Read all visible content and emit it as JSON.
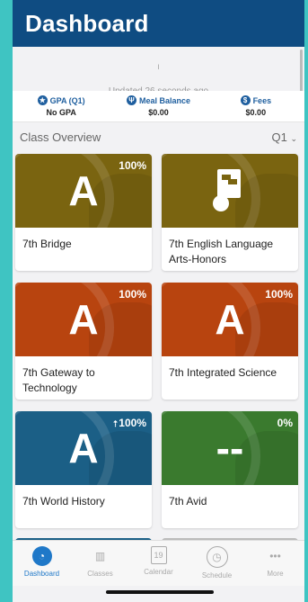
{
  "header": {
    "title": "Dashboard"
  },
  "refresh": {
    "indicator": "ı",
    "updated": "Updated 26 seconds ago"
  },
  "summary": [
    {
      "icon": "star-icon",
      "label": "GPA (Q1)",
      "value": "No GPA"
    },
    {
      "icon": "meal-icon",
      "label": "Meal Balance",
      "value": "$0.00"
    },
    {
      "icon": "dollar-icon",
      "label": "Fees",
      "value": "$0.00"
    }
  ],
  "overview": {
    "title": "Class Overview",
    "quarter": "Q1"
  },
  "classes": [
    {
      "name": "7th Bridge",
      "grade": "A",
      "percent": "100%",
      "color": "#7a6410"
    },
    {
      "name": "7th English Language Arts-Honors",
      "grade": "",
      "percent": "",
      "color": "#7a6410"
    },
    {
      "name": "7th Gateway to Technology",
      "grade": "A",
      "percent": "100%",
      "color": "#b8440f"
    },
    {
      "name": "7th Integrated Science",
      "grade": "A",
      "percent": "100%",
      "color": "#b8440f"
    },
    {
      "name": "7th World History",
      "grade": "A",
      "percent": "100%",
      "color": "#1b5f86"
    },
    {
      "name": "7th Avid",
      "grade": "--",
      "percent": "0%",
      "color": "#3a7a2e"
    }
  ],
  "tabs": [
    {
      "label": "Dashboard",
      "icon": "dashboard-icon",
      "active": true
    },
    {
      "label": "Classes",
      "icon": "classes-icon",
      "active": false
    },
    {
      "label": "Calendar",
      "icon": "calendar-icon",
      "active": false
    },
    {
      "label": "Schedule",
      "icon": "schedule-icon",
      "active": false
    },
    {
      "label": "More",
      "icon": "more-icon",
      "active": false
    }
  ]
}
